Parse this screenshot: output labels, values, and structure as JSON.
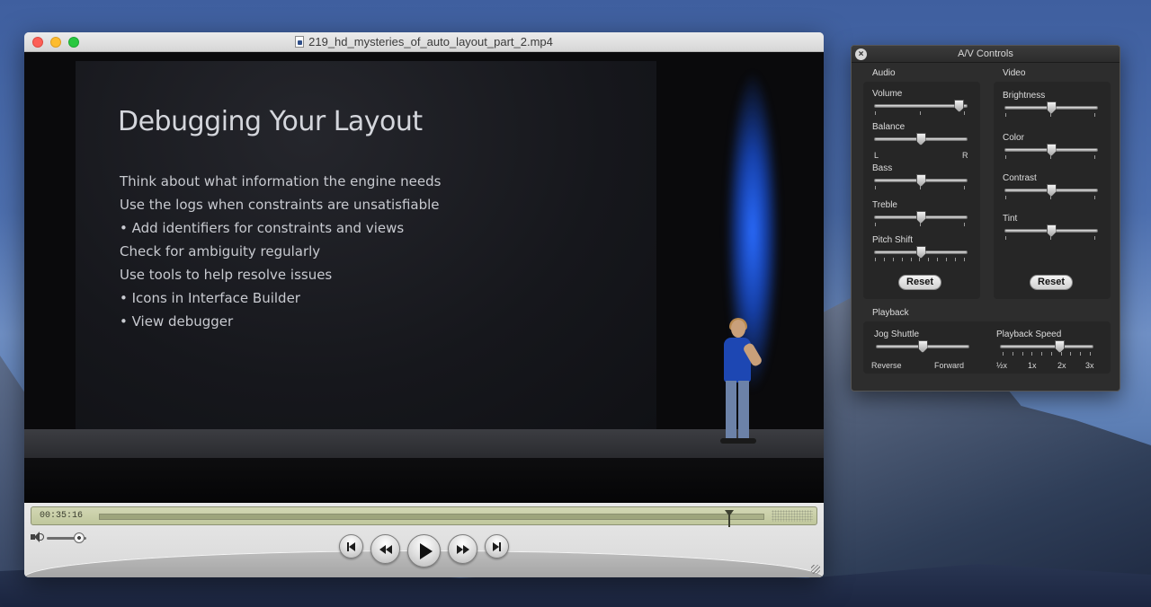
{
  "window": {
    "title": "219_hd_mysteries_of_auto_layout_part_2.mp4"
  },
  "slide": {
    "title": "Debugging Your Layout",
    "lines": [
      "Think about what information the engine needs",
      "Use the logs when constraints are unsatisfiable",
      "•  Add identifiers for constraints and views",
      "Check for ambiguity regularly",
      "Use tools to help resolve issues",
      "•  Icons in Interface Builder",
      "•  View debugger"
    ]
  },
  "player": {
    "current_time": "00:35:16",
    "progress": 0.948,
    "volume": 0.82,
    "buttons": [
      "skip-to-start",
      "rewind",
      "play",
      "fast-forward",
      "skip-to-end"
    ]
  },
  "av_controls": {
    "title": "A/V Controls",
    "audio": {
      "label": "Audio",
      "volume": {
        "label": "Volume",
        "value": 0.97
      },
      "balance": {
        "label": "Balance",
        "value": 0.5,
        "left": "L",
        "right": "R"
      },
      "bass": {
        "label": "Bass",
        "value": 0.5
      },
      "treble": {
        "label": "Treble",
        "value": 0.5
      },
      "pitch_shift": {
        "label": "Pitch Shift",
        "value": 0.5
      },
      "reset_label": "Reset"
    },
    "video": {
      "label": "Video",
      "brightness": {
        "label": "Brightness",
        "value": 0.5
      },
      "color": {
        "label": "Color",
        "value": 0.5
      },
      "contrast": {
        "label": "Contrast",
        "value": 0.5
      },
      "tint": {
        "label": "Tint",
        "value": 0.5
      },
      "reset_label": "Reset"
    },
    "playback": {
      "label": "Playback",
      "jog_shuttle": {
        "label": "Jog Shuttle",
        "value": 0.5,
        "left": "Reverse",
        "right": "Forward"
      },
      "playback_speed": {
        "label": "Playback Speed",
        "value": 0.66,
        "ticks": [
          "½x",
          "1x",
          "2x",
          "3x"
        ]
      }
    }
  },
  "colors": {
    "accent_blue": "#1d47b3",
    "timebar_lcd": "#c0c79c",
    "panel_bg": "#2d2d2d"
  }
}
